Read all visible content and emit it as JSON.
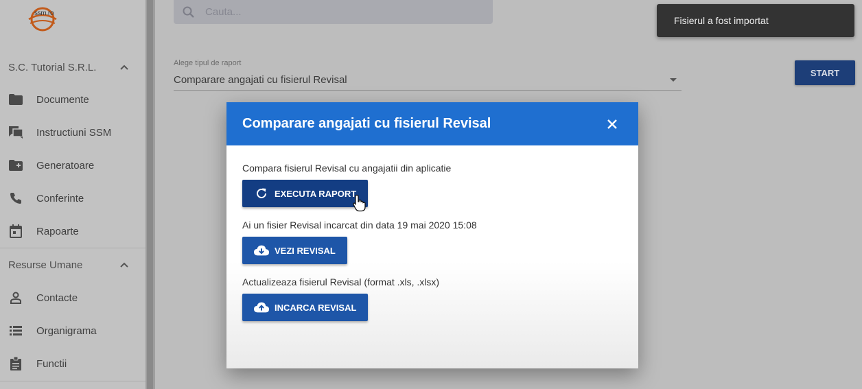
{
  "sidebar": {
    "logo_text": "ssm.ro",
    "groups": [
      {
        "title": "S.C. Tutorial S.R.L.",
        "items": [
          {
            "label": "Documente",
            "icon": "folder-icon"
          },
          {
            "label": "Instructiuni SSM",
            "icon": "forum-icon"
          },
          {
            "label": "Generatoare",
            "icon": "folder-plus-icon"
          },
          {
            "label": "Conferinte",
            "icon": "phone-icon"
          },
          {
            "label": "Rapoarte",
            "icon": "calendar-icon"
          }
        ]
      },
      {
        "title": "Resurse Umane",
        "items": [
          {
            "label": "Contacte",
            "icon": "person-icon"
          },
          {
            "label": "Organigrama",
            "icon": "list-icon"
          },
          {
            "label": "Functii",
            "icon": "clipboard-icon"
          }
        ]
      }
    ]
  },
  "search": {
    "placeholder": "Cauta..."
  },
  "report_select": {
    "label": "Alege tipul de raport",
    "value": "Comparare angajati cu fisierul Revisal"
  },
  "start_button": "START",
  "toast": "Fisierul a fost importat",
  "dialog": {
    "title": "Comparare angajati cu fisierul Revisal",
    "sections": [
      {
        "text": "Compara fisierul Revisal cu angajatii din aplicatie",
        "button": "EXECUTA RAPORT",
        "icon": "refresh-icon"
      },
      {
        "text": "Ai un fisier Revisal incarcat din data 19 mai 2020 15:08",
        "button": "VEZI REVISAL",
        "icon": "cloud-download-icon"
      },
      {
        "text": "Actualizeaza fisierul Revisal (format .xls, .xlsx)",
        "button": "INCARCA REVISAL",
        "icon": "cloud-upload-icon"
      }
    ]
  },
  "colors": {
    "dialog_header": "#1f6fd0",
    "button": "#1e56a8",
    "button_hover": "#133d83",
    "toast_bg": "#333333"
  }
}
